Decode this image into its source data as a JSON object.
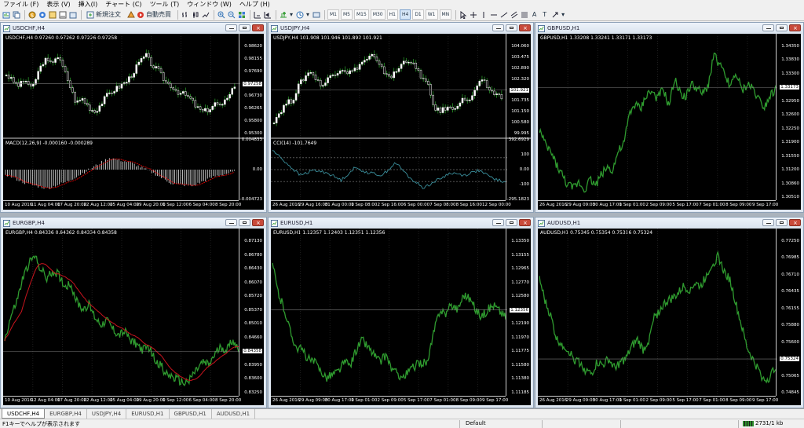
{
  "menu": [
    "ファイル (F)",
    "表示 (V)",
    "挿入(I)",
    "チャート (C)",
    "ツール (T)",
    "ウィンドウ (W)",
    "ヘルプ (H)"
  ],
  "toolbar": {
    "new_order": "新規注文",
    "auto_trading": "自動売買",
    "timeframes": [
      "M1",
      "M5",
      "M15",
      "M30",
      "H1",
      "H4",
      "D1",
      "W1",
      "MN"
    ],
    "active_timeframe": "H4",
    "text_tool": "A",
    "label_tool": "T"
  },
  "colors": {
    "bull": "#ffffff",
    "bear": "#ffffff",
    "line_chart": "#2f9b2f",
    "macd_signal": "#ff0000",
    "ma_line": "#c8141e",
    "cci_line": "#3a8f9c"
  },
  "windows": [
    {
      "id": "usdchf",
      "title": "USDCHF,H4",
      "info": "USDCHF,H4  0.97260 0.97262 0.97226 0.97258",
      "style": "candles",
      "y_labels": [
        "0.98620",
        "0.98155",
        "0.97690",
        "0.97258",
        "0.96730",
        "0.96265",
        "0.95800",
        "0.95300"
      ],
      "current_price": "0.97258",
      "indicator": {
        "name": "MACD(12,26,9) -0.000160 -0.000289",
        "type": "macd",
        "y_labels": [
          "0.004833",
          "0.00",
          "-0.004723"
        ]
      },
      "x_labels": [
        "10 Aug 2016",
        "11 Aug 04:00",
        "17 Aug 20:00",
        "22 Aug 12:00",
        "25 Aug 04:00",
        "29 Aug 20:00",
        "1 Sep 12:00",
        "6 Sep 04:00",
        "8 Sep 20:00"
      ]
    },
    {
      "id": "usdjpy",
      "title": "USDJPY,H4",
      "info": "USDJPY,H4  101.908 101.946 101.892 101.921",
      "style": "candles",
      "y_labels": [
        "104.060",
        "103.475",
        "102.890",
        "102.320",
        "101.921",
        "101.735",
        "101.150",
        "100.580",
        "99.995"
      ],
      "current_price": "101.921",
      "indicator": {
        "name": "CCI(14) -101.7649",
        "type": "cci",
        "y_labels": [
          "392.6929",
          "100",
          "0.00",
          "-100",
          "-295.1823"
        ]
      },
      "x_labels": [
        "26 Aug 2016",
        "29 Aug 16:00",
        "31 Aug 00:00",
        "1 Sep 08:00",
        "2 Sep 16:00",
        "6 Sep 00:00",
        "7 Sep 08:00",
        "8 Sep 16:00",
        "12 Sep 00:00"
      ]
    },
    {
      "id": "gbpusd",
      "title": "GBPUSD,H1",
      "info": "GBPUSD,H1  1.33208 1.33241 1.33171 1.33173",
      "style": "line",
      "y_labels": [
        "1.34350",
        "1.33830",
        "1.33300",
        "1.33173",
        "1.32950",
        "1.32600",
        "1.32250",
        "1.31900",
        "1.31550",
        "1.31200",
        "1.30860",
        "1.30510"
      ],
      "current_price": "1.33173",
      "x_labels": [
        "26 Aug 2016",
        "29 Aug 09:00",
        "30 Aug 17:00",
        "1 Sep 01:00",
        "2 Sep 09:00",
        "5 Sep 17:00",
        "7 Sep 01:00",
        "8 Sep 09:00",
        "9 Sep 17:00"
      ]
    },
    {
      "id": "eurgbp",
      "title": "EURGBP,H4",
      "info": "EURGBP,H4  0.84336 0.84362 0.84334 0.84358",
      "style": "line_ma",
      "y_labels": [
        "0.87130",
        "0.86780",
        "0.86430",
        "0.86070",
        "0.85720",
        "0.85370",
        "0.85010",
        "0.84660",
        "0.84358",
        "0.83950",
        "0.83600",
        "0.83250"
      ],
      "current_price": "0.84358",
      "x_labels": [
        "10 Aug 2016",
        "12 Aug 04:00",
        "17 Aug 20:00",
        "22 Aug 12:00",
        "25 Aug 04:00",
        "29 Aug 20:00",
        "1 Sep 12:00",
        "6 Sep 04:00",
        "8 Sep 20:00"
      ]
    },
    {
      "id": "eurusd",
      "title": "EURUSD,H1",
      "info": "EURUSD,H1  1.12357 1.12403 1.12351 1.12356",
      "style": "line",
      "y_labels": [
        "1.13350",
        "1.13155",
        "1.12965",
        "1.12770",
        "1.12580",
        "1.12356",
        "1.12190",
        "1.11970",
        "1.11775",
        "1.11580",
        "1.11380",
        "1.11185"
      ],
      "current_price": "1.12356",
      "x_labels": [
        "26 Aug 2016",
        "29 Aug 09:00",
        "30 Aug 17:00",
        "1 Sep 01:00",
        "2 Sep 09:00",
        "5 Sep 17:00",
        "7 Sep 01:00",
        "8 Sep 09:00",
        "9 Sep 17:00"
      ]
    },
    {
      "id": "audusd",
      "title": "AUDUSD,H1",
      "info": "AUDUSD,H1  0.75345 0.75354 0.75316 0.75324",
      "style": "line",
      "y_labels": [
        "0.77250",
        "0.76985",
        "0.76710",
        "0.76435",
        "0.76155",
        "0.75880",
        "0.75600",
        "0.75324",
        "0.75065",
        "0.74845"
      ],
      "current_price": "0.75324",
      "x_labels": [
        "26 Aug 2016",
        "29 Aug 09:00",
        "30 Aug 17:00",
        "1 Sep 01:00",
        "2 Sep 09:00",
        "5 Sep 17:00",
        "7 Sep 01:00",
        "8 Sep 09:00",
        "9 Sep 17:00"
      ]
    }
  ],
  "tabs": [
    "USDCHF,H4",
    "EURGBP,H4",
    "USDJPY,H4",
    "EURUSD,H1",
    "GBPUSD,H1",
    "AUDUSD,H1"
  ],
  "active_tab": "USDCHF,H4",
  "status": {
    "help": "F1キーでヘルプが表示されます",
    "profile": "Default",
    "traffic": "2731/1 kb"
  }
}
